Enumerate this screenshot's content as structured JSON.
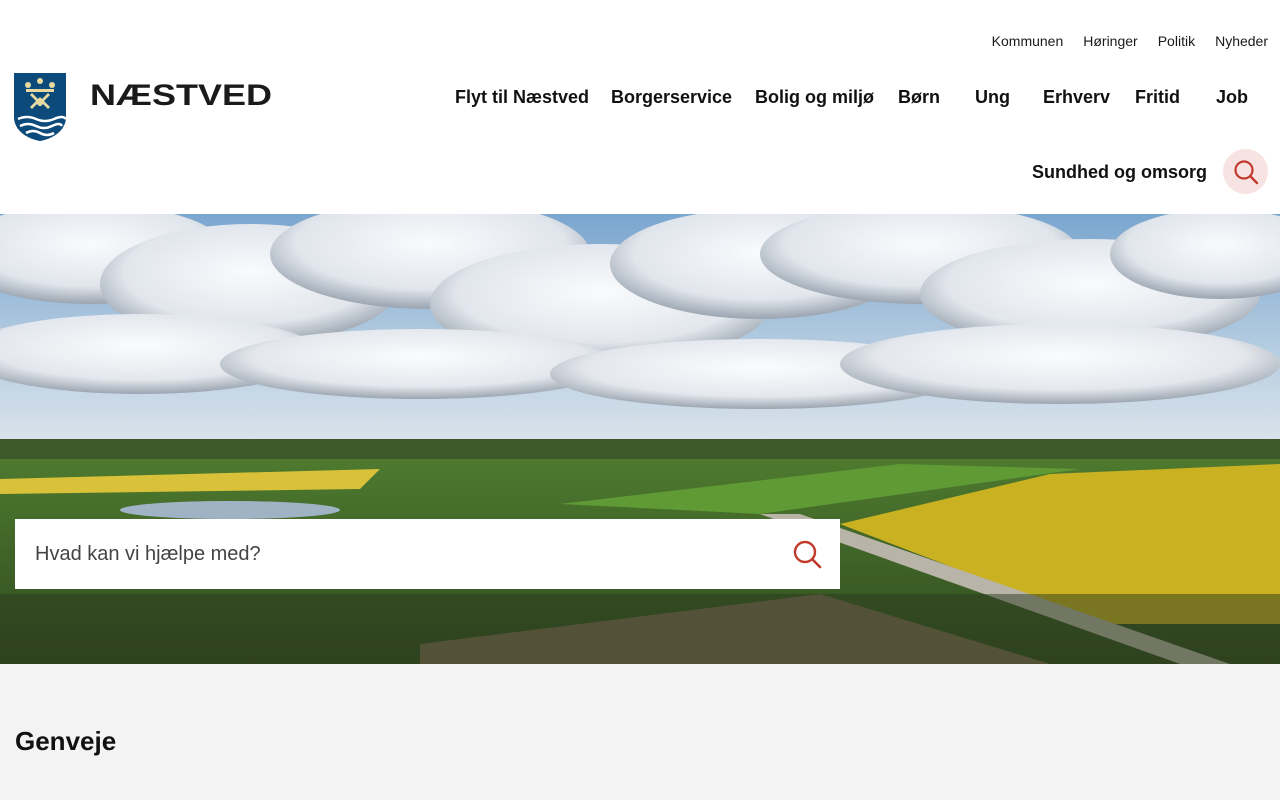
{
  "utility_nav": [
    "Kommunen",
    "Høringer",
    "Politik",
    "Nyheder"
  ],
  "main_nav": [
    "Flyt til Næstved",
    "Borgerservice",
    "Bolig og miljø",
    "Børn",
    "Ung",
    "Erhverv",
    "Fritid",
    "Job",
    "Sundhed og omsorg"
  ],
  "logo": {
    "wordmark": "NÆSTVED"
  },
  "hero": {
    "search_placeholder": "Hvad kan vi hjælpe med?"
  },
  "shortcuts": {
    "title": "Genveje"
  },
  "colors": {
    "accent": "#c0392b",
    "crest_blue": "#0b4a7a",
    "search_btn_bg": "#f8e3e3",
    "section_bg": "#f3f3f3"
  }
}
